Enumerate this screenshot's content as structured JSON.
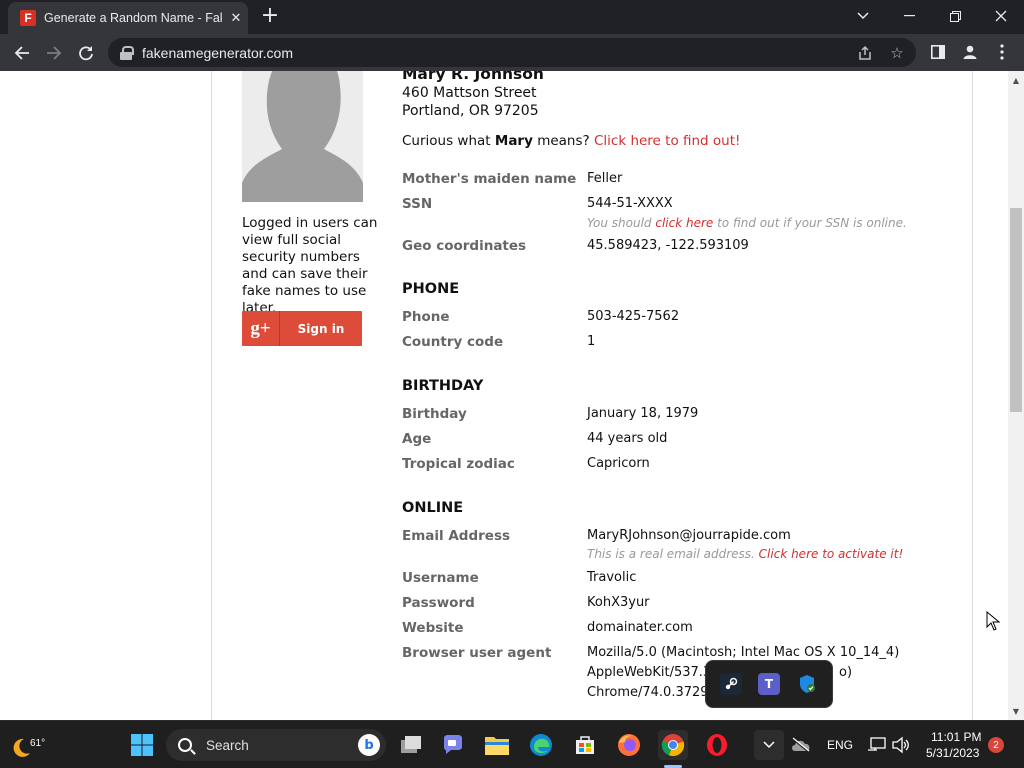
{
  "browser": {
    "tab_title": "Generate a Random Name - Fake Name Generator",
    "tab_favicon": "F",
    "url": "fakenamegenerator.com",
    "theme_dark": "#202124",
    "theme_toolbar": "#35363a"
  },
  "profile": {
    "name": "Mary R. Johnson",
    "address_line1": "460 Mattson Street",
    "address_line2": "Portland, OR 97205",
    "curious_prefix": "Curious what ",
    "curious_name": "Mary",
    "curious_suffix": " means? ",
    "curious_link": "Click here to find out!",
    "sidebar_text": "Logged in users can view full social security numbers and can save their fake names to use later.",
    "gplus_label": "Sign in",
    "gplus_logo": "g+",
    "identity": [
      {
        "label": "Mother's maiden name",
        "value": "Feller"
      },
      {
        "label": "SSN",
        "value": "544-51-XXXX",
        "note_prefix": "You should ",
        "note_link": "click here",
        "note_suffix": " to find out if your SSN is online."
      },
      {
        "label": "Geo coordinates",
        "value": "45.589423, -122.593109"
      }
    ],
    "phone_title": "PHONE",
    "phone": [
      {
        "label": "Phone",
        "value": "503-425-7562"
      },
      {
        "label": "Country code",
        "value": "1"
      }
    ],
    "birthday_title": "BIRTHDAY",
    "birthday": [
      {
        "label": "Birthday",
        "value": "January 18, 1979"
      },
      {
        "label": "Age",
        "value": "44 years old"
      },
      {
        "label": "Tropical zodiac",
        "value": "Capricorn"
      }
    ],
    "online_title": "ONLINE",
    "online": [
      {
        "label": "Email Address",
        "value": "MaryRJohnson@jourrapide.com",
        "note_prefix": "This is a real email address. ",
        "note_link": "Click here to activate it!"
      },
      {
        "label": "Username",
        "value": "Travolic"
      },
      {
        "label": "Password",
        "value": "KohX3yur"
      },
      {
        "label": "Website",
        "value": "domainater.com"
      },
      {
        "label": "Browser user agent",
        "value_line1": "Mozilla/5.0 (Macintosh; Intel Mac OS X 10_14_4)",
        "value_line2": "AppleWebKit/537.3",
        "value_line2_tail": "o)",
        "value_line3": "Chrome/74.0.3729."
      }
    ],
    "accent_red": "#d32f2f"
  },
  "taskbar": {
    "temperature": "61°",
    "search_placeholder": "Search",
    "language": "ENG",
    "time": "11:01 PM",
    "date": "5/31/2023",
    "notification_count": "2",
    "pinned": [
      "start-icon",
      "search",
      "task-view-icon",
      "chat-icon",
      "file-explorer-icon",
      "edge-icon",
      "store-icon",
      "firefox-icon",
      "chrome-icon",
      "opera-icon"
    ],
    "tray_flyout": [
      "steam-icon",
      "teams-icon",
      "defender-icon"
    ]
  }
}
